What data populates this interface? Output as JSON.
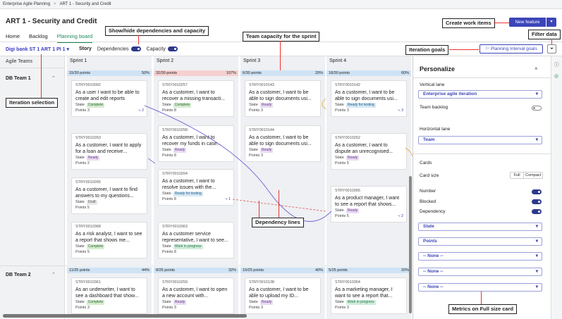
{
  "breadcrumb": {
    "root": "Enterprise Agile Planning",
    "sep": ">",
    "current": "ART 1 - Security and Credit"
  },
  "page_title": "ART 1 - Security and Credit",
  "tabs": [
    {
      "label": "Home"
    },
    {
      "label": "Backlog"
    },
    {
      "label": "Planning board"
    }
  ],
  "toolbar": {
    "selection": "Digi bank ST 1 ART 1 PI 1",
    "story": "Story",
    "dependencies": "Dependencies",
    "capacity": "Capacity"
  },
  "buttons": {
    "new_feature": "New feature",
    "planning_goals": "Planning Interval goals"
  },
  "left": {
    "header": "Agile Teams",
    "team1": "DB Team 1",
    "team2": "DB Team 2"
  },
  "sprints": [
    {
      "name": "Sprint 1",
      "cap1": "15/30 points",
      "pct1": "50%",
      "cap2": "11/25 points",
      "pct2": "44%"
    },
    {
      "name": "Sprint 2",
      "cap1": "32/30 points",
      "pct1": "107%",
      "cap2": "8/25 points",
      "pct2": "32%"
    },
    {
      "name": "Sprint 3",
      "cap1": "6/30 points",
      "pct1": "20%",
      "cap2": "10/25 points",
      "pct2": "40%"
    },
    {
      "name": "Sprint 4",
      "cap1": "18/30 points",
      "pct1": "60%",
      "cap2": "5/25 points",
      "pct2": "20%"
    }
  ],
  "cards": [
    {
      "id": "STRY0010002",
      "title": "As a user I want to be able to create and edit reports",
      "state": "Complete",
      "points": "3",
      "deps": "2"
    },
    {
      "id": "STRY0010263",
      "title": "As a customer, I want to apply for a loan and receive...",
      "state": "Ready",
      "points": "2"
    },
    {
      "id": "STRY0010265",
      "title": "As a customer, I want to find answers to my questions...",
      "state": "Draft",
      "points": "5"
    },
    {
      "id": "STRY0010368",
      "title": "As a risk analyst, I want to see a report that shows me...",
      "state": "Complete",
      "points": "5"
    },
    {
      "id": "STRY0010257",
      "title": "As a customer, I want to recover a missing transacti...",
      "state": "Complete",
      "points": "8"
    },
    {
      "id": "STRY0010258",
      "title": "As a customer, I want to recover my funds in case...",
      "state": "Ready",
      "points": "8"
    },
    {
      "id": "STRY0010264",
      "title": "As a customer, I want to resolve issues with the...",
      "state": "Ready for testing",
      "points": "8",
      "deps": "1"
    },
    {
      "id": "STRY0010363",
      "title": "As a customer service representative, I want to see...",
      "state": "Work in progress",
      "points": "8"
    },
    {
      "id": "STRY0010143",
      "title": "As a customer, I want to be able to sign documents usi...",
      "state": "Ready",
      "points": "3"
    },
    {
      "id": "STRY0010144",
      "title": "As a customer, I want to be able to sign documents usi...",
      "state": "Ready",
      "points": "3"
    },
    {
      "id": "STRY0010142",
      "title": "As a customer, I want to be able to sign documents usi...",
      "state": "Ready for testing",
      "points": "3",
      "deps": "3"
    },
    {
      "id": "STRY0010262",
      "title": "As a customer, I want to dispute an unrecognised...",
      "state": "Ready",
      "points": "5"
    },
    {
      "id": "STRY0010365",
      "title": "As a product manager, I want to see a report that shows...",
      "state": "Ready",
      "points": "5",
      "deps": "2"
    },
    {
      "id": "STRY0010361",
      "title": "As an underwriter, I want to see a dashboard that show...",
      "state": "Complete",
      "points": "3"
    },
    {
      "id": "STRY0010259",
      "title": "As a customer, I want to open a new account with...",
      "state": "Ready",
      "points": "3"
    },
    {
      "id": "STRY0010138",
      "title": "As a customer, I want to be able to upload my ID...",
      "state": "Ready",
      "points": "3"
    },
    {
      "id": "STRY0010364",
      "title": "As a marketing manager, I want to see a report that...",
      "state": "Work in progress",
      "points": "3"
    }
  ],
  "labels": {
    "state": "State",
    "points": "Points"
  },
  "panel": {
    "title": "Personalize",
    "vertical_lane": "Vertical lane",
    "vertical_value": "Enterprise agile iteration",
    "team_backlog": "Team backlog",
    "horizontal_lane": "Horizontal lane",
    "horizontal_value": "Team",
    "cards": "Cards",
    "card_size": "Card size",
    "full": "Full",
    "compact": "Compact",
    "number": "Number",
    "blocked": "Blocked",
    "dependency": "Dependency",
    "metric1": "State",
    "metric2": "Points",
    "metric3": "-- None --",
    "metric4": "-- None --",
    "metric5": "-- None --"
  },
  "callouts": {
    "create": "Create work items",
    "showhide": "Show/hide dependencies and capacity",
    "capacity": "Team capacity for the sprint",
    "filter": "Filter data",
    "goals": "Iteration goals",
    "iteration": "Iteration selection",
    "deplines": "Dependency lines",
    "metrics": "Metrics on Full size card"
  },
  "colors": {
    "accent": "#3c45b8",
    "annotation": "#e33333",
    "cap_blue": "#cfe3f5",
    "cap_red": "#f6d0d0"
  }
}
